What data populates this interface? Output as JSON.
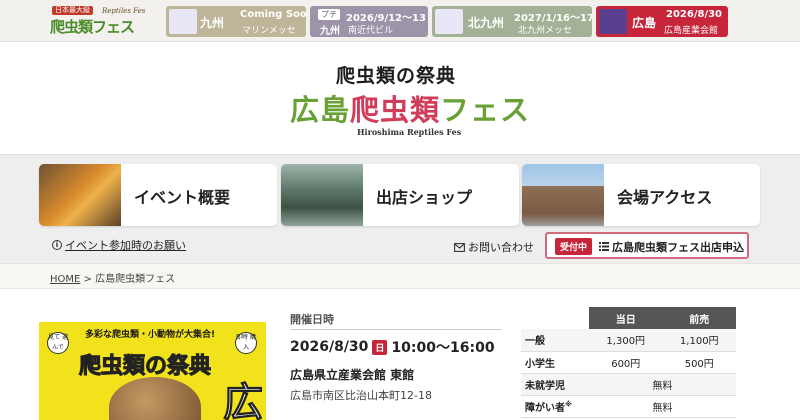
{
  "topbar": {
    "logo": {
      "tag": "日本最大級",
      "name": "爬虫類フェス",
      "en": "Reptiles Fes"
    },
    "events": [
      {
        "region": "九州",
        "date": "Coming Soon",
        "venue": "マリンメッセ"
      },
      {
        "prefix": "プチ",
        "region": "九州",
        "date": "2026/9/12～13",
        "venue": "南近代ビル"
      },
      {
        "region": "北九州",
        "date": "2027/1/16～17",
        "venue": "北九州メッセ"
      },
      {
        "region": "広島",
        "date": "2026/8/30",
        "venue": "広島産業会館"
      }
    ]
  },
  "hero": {
    "title_top": "爬虫類の祭典",
    "title_main_a": "広島",
    "title_main_b": "爬虫類",
    "title_main_c": "フェス",
    "title_en": "Hiroshima Reptiles Fes"
  },
  "nav": {
    "items": [
      {
        "label": "イベント概要"
      },
      {
        "label": "出店ショップ"
      },
      {
        "label": "会場アクセス"
      }
    ],
    "notice": "イベント参加時のお願い",
    "contact": "お問い合わせ",
    "apply_badge": "受付中",
    "apply_label": "広島爬虫類フェス出店申込"
  },
  "breadcrumb": {
    "home": "HOME",
    "sep": ">",
    "current": "広島爬虫類フェス"
  },
  "poster": {
    "tagline": "多彩な爬虫類・小動物が大集合!",
    "title": "爬虫類の祭典",
    "big": "広",
    "left_badge": "見て 選んで",
    "right_badge": "即時 購入"
  },
  "event_info": {
    "label": "開催日時",
    "date": "2026/8/30",
    "day": "日",
    "time": "10:00～16:00",
    "venue": "広島県立産業会館 東館",
    "address": "広島市南区比治山本町12-18"
  },
  "prices": {
    "headers": [
      "当日",
      "前売"
    ],
    "rows": [
      {
        "cat": "一般",
        "today": "1,300円",
        "advance": "1,100円"
      },
      {
        "cat": "小学生",
        "today": "600円",
        "advance": "500円"
      },
      {
        "cat": "未就学児",
        "both": "無料"
      },
      {
        "cat": "障がい者",
        "note": "※",
        "both": "無料"
      }
    ]
  },
  "colors": {
    "accent_red": "#c7253a",
    "brand_green": "#6aa136",
    "brand_pink": "#d23c5b"
  }
}
